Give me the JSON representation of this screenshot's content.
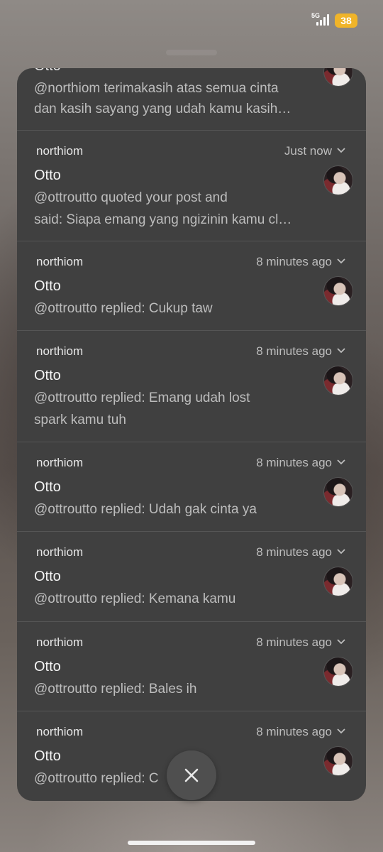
{
  "status_bar": {
    "network": "5G",
    "battery": "38",
    "battery_color": "#f0b429"
  },
  "partial_notification": {
    "title": "Otto",
    "message_lines": [
      "@northiom terimakasih atas semua cinta",
      "dan kasih sayang yang udah kamu kasih…"
    ]
  },
  "notifications": [
    {
      "app": "northiom",
      "time": "Just now",
      "title": "Otto",
      "message_lines": [
        "@ottroutto quoted your post and",
        "said: Siapa emang yang ngizinin kamu cl…"
      ]
    },
    {
      "app": "northiom",
      "time": "8 minutes ago",
      "title": "Otto",
      "message_lines": [
        "@ottroutto replied: Cukup taw"
      ]
    },
    {
      "app": "northiom",
      "time": "8 minutes ago",
      "title": "Otto",
      "message_lines": [
        "@ottroutto replied: Emang udah lost",
        "spark kamu tuh"
      ]
    },
    {
      "app": "northiom",
      "time": "8 minutes ago",
      "title": "Otto",
      "message_lines": [
        "@ottroutto replied: Udah gak cinta ya"
      ]
    },
    {
      "app": "northiom",
      "time": "8 minutes ago",
      "title": "Otto",
      "message_lines": [
        "@ottroutto replied: Kemana kamu"
      ]
    },
    {
      "app": "northiom",
      "time": "8 minutes ago",
      "title": "Otto",
      "message_lines": [
        "@ottroutto replied: Bales ih"
      ]
    },
    {
      "app": "northiom",
      "time": "8 minutes ago",
      "title": "Otto",
      "message_lines": [
        "@ottroutto replied: C"
      ]
    }
  ],
  "icons": {
    "chevron": "chevron-down-icon",
    "close": "close-icon",
    "avatar": "avatar"
  },
  "colors": {
    "panel": "#404040",
    "text_primary": "#f4f4f4",
    "text_secondary": "#bdbdbd"
  }
}
